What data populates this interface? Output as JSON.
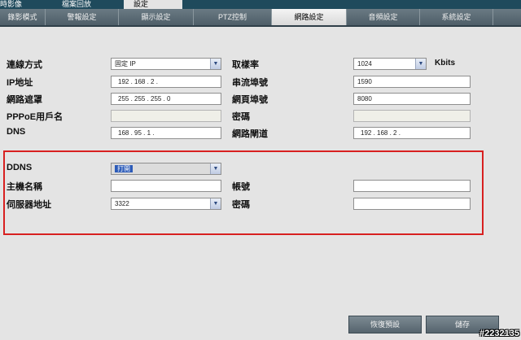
{
  "top_tabs": [
    "時影像",
    "檔案回放",
    "設定"
  ],
  "sub_tabs": [
    "錄影模式",
    "警報設定",
    "顯示設定",
    "PTZ控制",
    "網路設定",
    "音頻設定",
    "系統設定"
  ],
  "network": {
    "connection_type_label": "連線方式",
    "connection_type_value": "固定 IP",
    "ip_label": "IP地址",
    "ip_value": "192 . 168 . 2 .",
    "subnet_label": "網路遮罩",
    "subnet_value": "255 . 255 . 255 . 0",
    "pppoe_label": "PPPoE用戶名",
    "pppoe_value": "",
    "dns_label": "DNS",
    "dns_value": "168 . 95 . 1 .",
    "bitrate_label": "取樣率",
    "bitrate_value": "1024",
    "bitrate_unit": "Kbits",
    "stream_port_label": "串流埠號",
    "stream_port_value": "1590",
    "web_port_label": "網頁埠號",
    "web_port_value": "8080",
    "password_label": "密碼",
    "password_value": "",
    "gateway_label": "網路閘道",
    "gateway_value": "192 . 168 . 2 ."
  },
  "ddns": {
    "ddns_label": "DDNS",
    "ddns_value": "打開",
    "hostname_label": "主機名稱",
    "hostname_value": "",
    "server_label": "伺服器地址",
    "server_value": "3322",
    "account_label": "帳號",
    "account_value": "",
    "password_label": "密碼",
    "password_value": ""
  },
  "buttons": {
    "restore_label": "恢復預設",
    "save_label": "儲存"
  },
  "watermark": "#2232135",
  "colors": {
    "top_bar": "#1f4a5c",
    "highlight_border": "#d82020",
    "selected_option": "#2c5bb8"
  }
}
